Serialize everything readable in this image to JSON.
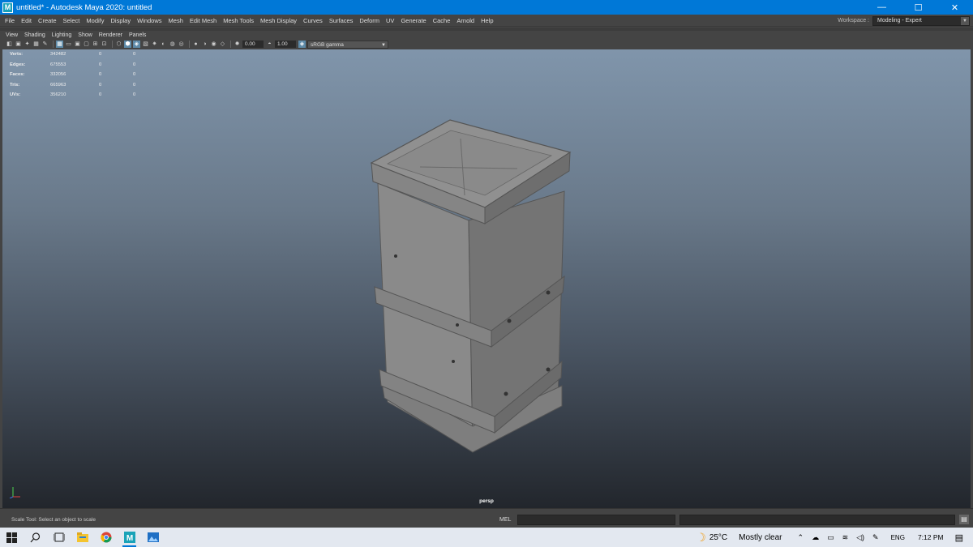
{
  "window": {
    "icon_letter": "M",
    "title": "untitled* - Autodesk Maya 2020: untitled",
    "controls": {
      "minimize": "—",
      "maximize": "☐",
      "close": "✕"
    }
  },
  "menubar": {
    "items": [
      "File",
      "Edit",
      "Create",
      "Select",
      "Modify",
      "Display",
      "Windows",
      "Mesh",
      "Edit Mesh",
      "Mesh Tools",
      "Mesh Display",
      "Curves",
      "Surfaces",
      "Deform",
      "UV",
      "Generate",
      "Cache",
      "Arnold",
      "Help"
    ],
    "workspace_label": "Workspace :",
    "workspace_value": "Modeling - Expert"
  },
  "panel_menu": {
    "items": [
      "View",
      "Shading",
      "Lighting",
      "Show",
      "Renderer",
      "Panels"
    ]
  },
  "viewport_toolbar": {
    "exposure_value": "0.00",
    "gamma_value": "1.00",
    "color_space": "sRGB gamma"
  },
  "hud": {
    "rows": [
      {
        "label": "Verts:",
        "total": "342482",
        "selected": "0",
        "components": "0"
      },
      {
        "label": "Edges:",
        "total": "675553",
        "selected": "0",
        "components": "0"
      },
      {
        "label": "Faces:",
        "total": "332056",
        "selected": "0",
        "components": "0"
      },
      {
        "label": "Tris:",
        "total": "665963",
        "selected": "0",
        "components": "0"
      },
      {
        "label": "UVs:",
        "total": "356210",
        "selected": "0",
        "components": "0"
      }
    ]
  },
  "viewport": {
    "camera_label": "persp",
    "colors": {
      "bg_top": "#8095ab",
      "bg_bottom": "#22262c",
      "model": "#7f7f7f"
    }
  },
  "helpline": {
    "text": "Scale Tool: Select an object to scale",
    "mel_label": "MEL"
  },
  "taskbar": {
    "weather_temp": "25°C",
    "weather_desc": "Mostly clear",
    "language": "ENG",
    "time": "7:12 PM",
    "accent": "#0078d7"
  }
}
